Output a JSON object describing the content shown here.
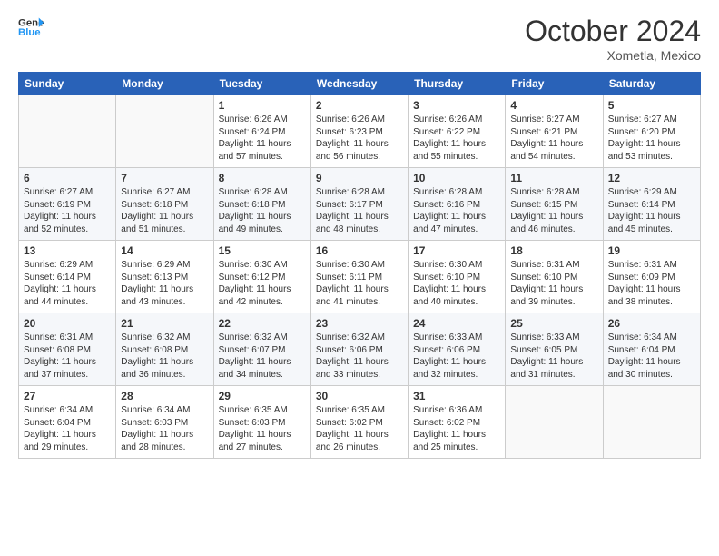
{
  "logo": {
    "line1": "General",
    "line2": "Blue"
  },
  "title": "October 2024",
  "location": "Xometla, Mexico",
  "days_header": [
    "Sunday",
    "Monday",
    "Tuesday",
    "Wednesday",
    "Thursday",
    "Friday",
    "Saturday"
  ],
  "weeks": [
    [
      {
        "num": "",
        "sunrise": "",
        "sunset": "",
        "daylight": ""
      },
      {
        "num": "",
        "sunrise": "",
        "sunset": "",
        "daylight": ""
      },
      {
        "num": "1",
        "sunrise": "Sunrise: 6:26 AM",
        "sunset": "Sunset: 6:24 PM",
        "daylight": "Daylight: 11 hours and 57 minutes."
      },
      {
        "num": "2",
        "sunrise": "Sunrise: 6:26 AM",
        "sunset": "Sunset: 6:23 PM",
        "daylight": "Daylight: 11 hours and 56 minutes."
      },
      {
        "num": "3",
        "sunrise": "Sunrise: 6:26 AM",
        "sunset": "Sunset: 6:22 PM",
        "daylight": "Daylight: 11 hours and 55 minutes."
      },
      {
        "num": "4",
        "sunrise": "Sunrise: 6:27 AM",
        "sunset": "Sunset: 6:21 PM",
        "daylight": "Daylight: 11 hours and 54 minutes."
      },
      {
        "num": "5",
        "sunrise": "Sunrise: 6:27 AM",
        "sunset": "Sunset: 6:20 PM",
        "daylight": "Daylight: 11 hours and 53 minutes."
      }
    ],
    [
      {
        "num": "6",
        "sunrise": "Sunrise: 6:27 AM",
        "sunset": "Sunset: 6:19 PM",
        "daylight": "Daylight: 11 hours and 52 minutes."
      },
      {
        "num": "7",
        "sunrise": "Sunrise: 6:27 AM",
        "sunset": "Sunset: 6:18 PM",
        "daylight": "Daylight: 11 hours and 51 minutes."
      },
      {
        "num": "8",
        "sunrise": "Sunrise: 6:28 AM",
        "sunset": "Sunset: 6:18 PM",
        "daylight": "Daylight: 11 hours and 49 minutes."
      },
      {
        "num": "9",
        "sunrise": "Sunrise: 6:28 AM",
        "sunset": "Sunset: 6:17 PM",
        "daylight": "Daylight: 11 hours and 48 minutes."
      },
      {
        "num": "10",
        "sunrise": "Sunrise: 6:28 AM",
        "sunset": "Sunset: 6:16 PM",
        "daylight": "Daylight: 11 hours and 47 minutes."
      },
      {
        "num": "11",
        "sunrise": "Sunrise: 6:28 AM",
        "sunset": "Sunset: 6:15 PM",
        "daylight": "Daylight: 11 hours and 46 minutes."
      },
      {
        "num": "12",
        "sunrise": "Sunrise: 6:29 AM",
        "sunset": "Sunset: 6:14 PM",
        "daylight": "Daylight: 11 hours and 45 minutes."
      }
    ],
    [
      {
        "num": "13",
        "sunrise": "Sunrise: 6:29 AM",
        "sunset": "Sunset: 6:14 PM",
        "daylight": "Daylight: 11 hours and 44 minutes."
      },
      {
        "num": "14",
        "sunrise": "Sunrise: 6:29 AM",
        "sunset": "Sunset: 6:13 PM",
        "daylight": "Daylight: 11 hours and 43 minutes."
      },
      {
        "num": "15",
        "sunrise": "Sunrise: 6:30 AM",
        "sunset": "Sunset: 6:12 PM",
        "daylight": "Daylight: 11 hours and 42 minutes."
      },
      {
        "num": "16",
        "sunrise": "Sunrise: 6:30 AM",
        "sunset": "Sunset: 6:11 PM",
        "daylight": "Daylight: 11 hours and 41 minutes."
      },
      {
        "num": "17",
        "sunrise": "Sunrise: 6:30 AM",
        "sunset": "Sunset: 6:10 PM",
        "daylight": "Daylight: 11 hours and 40 minutes."
      },
      {
        "num": "18",
        "sunrise": "Sunrise: 6:31 AM",
        "sunset": "Sunset: 6:10 PM",
        "daylight": "Daylight: 11 hours and 39 minutes."
      },
      {
        "num": "19",
        "sunrise": "Sunrise: 6:31 AM",
        "sunset": "Sunset: 6:09 PM",
        "daylight": "Daylight: 11 hours and 38 minutes."
      }
    ],
    [
      {
        "num": "20",
        "sunrise": "Sunrise: 6:31 AM",
        "sunset": "Sunset: 6:08 PM",
        "daylight": "Daylight: 11 hours and 37 minutes."
      },
      {
        "num": "21",
        "sunrise": "Sunrise: 6:32 AM",
        "sunset": "Sunset: 6:08 PM",
        "daylight": "Daylight: 11 hours and 36 minutes."
      },
      {
        "num": "22",
        "sunrise": "Sunrise: 6:32 AM",
        "sunset": "Sunset: 6:07 PM",
        "daylight": "Daylight: 11 hours and 34 minutes."
      },
      {
        "num": "23",
        "sunrise": "Sunrise: 6:32 AM",
        "sunset": "Sunset: 6:06 PM",
        "daylight": "Daylight: 11 hours and 33 minutes."
      },
      {
        "num": "24",
        "sunrise": "Sunrise: 6:33 AM",
        "sunset": "Sunset: 6:06 PM",
        "daylight": "Daylight: 11 hours and 32 minutes."
      },
      {
        "num": "25",
        "sunrise": "Sunrise: 6:33 AM",
        "sunset": "Sunset: 6:05 PM",
        "daylight": "Daylight: 11 hours and 31 minutes."
      },
      {
        "num": "26",
        "sunrise": "Sunrise: 6:34 AM",
        "sunset": "Sunset: 6:04 PM",
        "daylight": "Daylight: 11 hours and 30 minutes."
      }
    ],
    [
      {
        "num": "27",
        "sunrise": "Sunrise: 6:34 AM",
        "sunset": "Sunset: 6:04 PM",
        "daylight": "Daylight: 11 hours and 29 minutes."
      },
      {
        "num": "28",
        "sunrise": "Sunrise: 6:34 AM",
        "sunset": "Sunset: 6:03 PM",
        "daylight": "Daylight: 11 hours and 28 minutes."
      },
      {
        "num": "29",
        "sunrise": "Sunrise: 6:35 AM",
        "sunset": "Sunset: 6:03 PM",
        "daylight": "Daylight: 11 hours and 27 minutes."
      },
      {
        "num": "30",
        "sunrise": "Sunrise: 6:35 AM",
        "sunset": "Sunset: 6:02 PM",
        "daylight": "Daylight: 11 hours and 26 minutes."
      },
      {
        "num": "31",
        "sunrise": "Sunrise: 6:36 AM",
        "sunset": "Sunset: 6:02 PM",
        "daylight": "Daylight: 11 hours and 25 minutes."
      },
      {
        "num": "",
        "sunrise": "",
        "sunset": "",
        "daylight": ""
      },
      {
        "num": "",
        "sunrise": "",
        "sunset": "",
        "daylight": ""
      }
    ]
  ]
}
